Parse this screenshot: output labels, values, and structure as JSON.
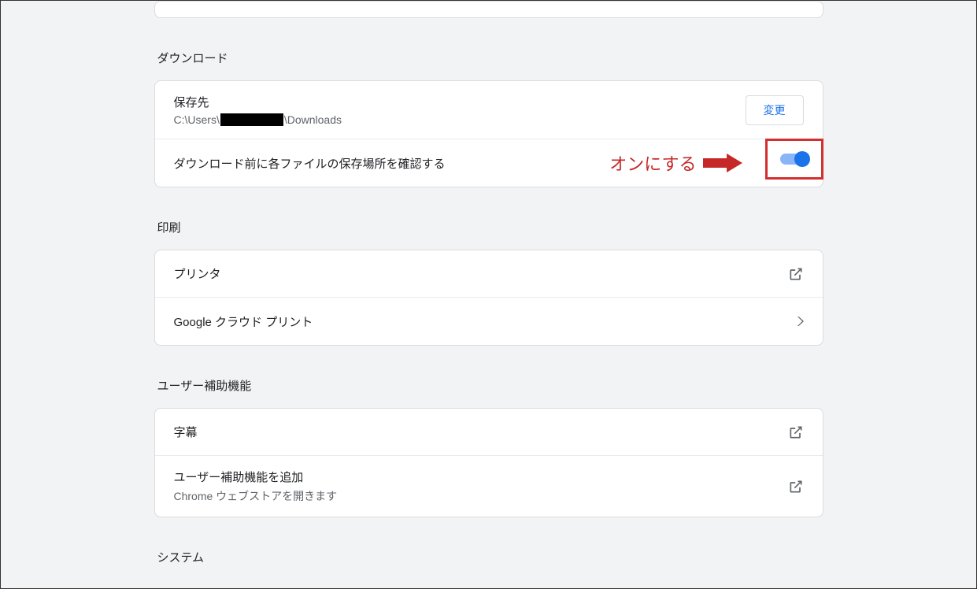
{
  "annotation_text": "オンにする",
  "sections": {
    "downloads": {
      "title": "ダウンロード",
      "location_label": "保存先",
      "location_prefix": "C:\\Users\\",
      "location_suffix": "\\Downloads",
      "change_button": "変更",
      "prompt_label": "ダウンロード前に各ファイルの保存場所を確認する"
    },
    "printing": {
      "title": "印刷",
      "printers_label": "プリンタ",
      "cloud_print_label": "Google クラウド プリント"
    },
    "accessibility": {
      "title": "ユーザー補助機能",
      "captions_label": "字幕",
      "add_label": "ユーザー補助機能を追加",
      "add_sub": "Chrome ウェブストアを開きます"
    },
    "system": {
      "title": "システム"
    }
  }
}
